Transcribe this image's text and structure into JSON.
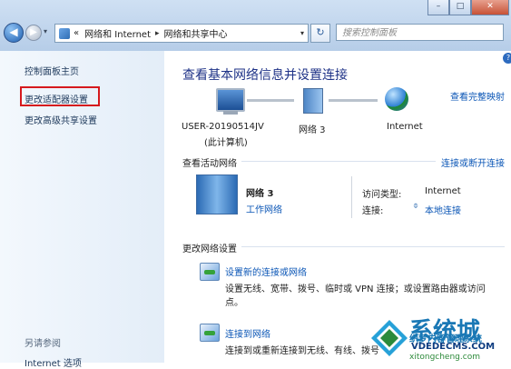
{
  "window": {
    "minimize_glyph": "–",
    "maximize_glyph": "□",
    "close_glyph": "✕"
  },
  "nav": {
    "back_glyph": "◀",
    "forward_glyph": "▶",
    "history_glyph": "▾",
    "breadcrumb_prefix": "«",
    "breadcrumb": [
      "网络和 Internet",
      "网络和共享中心"
    ],
    "breadcrumb_separator": "▸",
    "refresh_glyph": "↻",
    "search_placeholder": "搜索控制面板"
  },
  "sidebar": {
    "items": [
      {
        "label": "控制面板主页"
      },
      {
        "label": "更改适配器设置",
        "highlighted": true
      },
      {
        "label": "更改高级共享设置"
      }
    ],
    "see_also_heading": "另请参阅",
    "see_also_items": [
      "Internet 选项"
    ]
  },
  "main": {
    "title": "查看基本网络信息并设置连接",
    "view_full_map_link": "查看完整映射",
    "network_map": {
      "computer_name": "USER-20190514JV",
      "computer_note": "(此计算机)",
      "network_name": "网络  3",
      "internet_label": "Internet"
    },
    "active_networks": {
      "heading": "查看活动网络",
      "connect_link": "连接或断开连接",
      "network_name": "网络  3",
      "network_type": "工作网络",
      "access_type_label": "访问类型:",
      "access_type_value": "Internet",
      "connections_label": "连接:",
      "connection_value": "本地连接"
    },
    "change_settings": {
      "heading": "更改网络设置",
      "tasks": [
        {
          "title": "设置新的连接或网络",
          "desc_line1": "设置无线、宽带、拨号、临时或 VPN 连接；或设置路由器或访问",
          "desc_line2": "点。"
        },
        {
          "title": "连接到网络",
          "desc_line1": "连接到或重新连接到无线、有线、拨号",
          "desc_line2": ""
        }
      ]
    }
  },
  "watermark": {
    "big_text": "系统城",
    "line1": "织梦内容管理系统",
    "line2": "VDEDECMS.COM",
    "line3": "xitongcheng.com"
  },
  "colors": {
    "link": "#0b56b6",
    "title": "#1e3287",
    "highlight_border": "#d6191d"
  }
}
